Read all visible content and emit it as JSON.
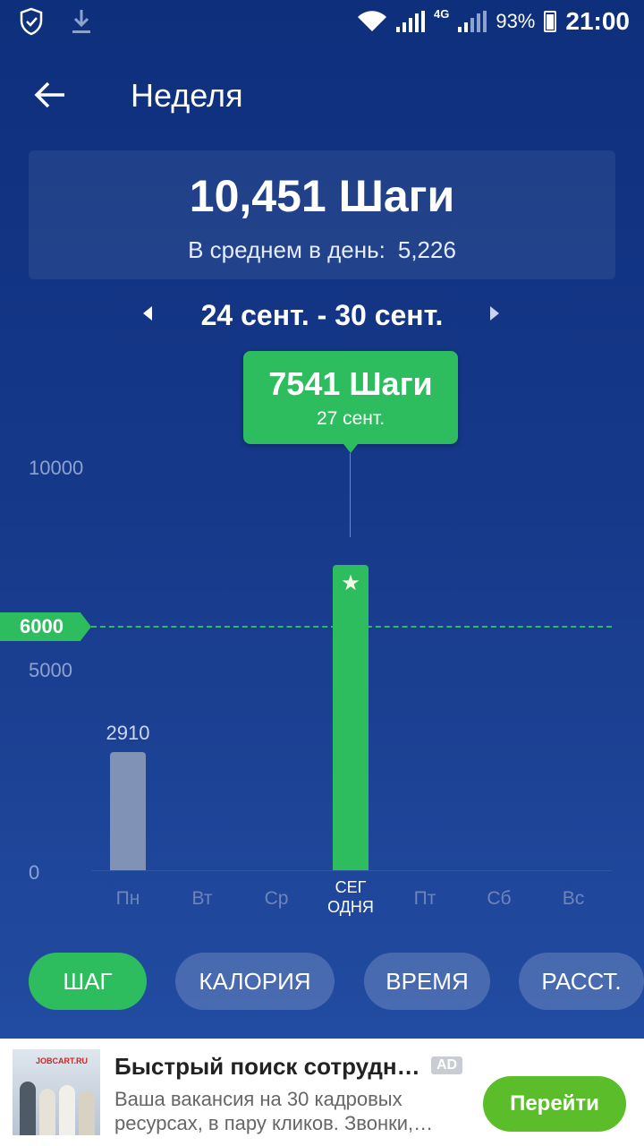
{
  "status": {
    "battery": "93%",
    "time": "21:00",
    "network": "4G",
    "icons": [
      "shield-check-icon",
      "download-icon",
      "wifi-icon",
      "signal-icon",
      "battery-icon"
    ]
  },
  "appbar": {
    "title": "Неделя",
    "back_icon": "arrow-left-icon"
  },
  "summary": {
    "total": "10,451 Шаги",
    "avg_label": "В среднем в день:",
    "avg_value": "5,226"
  },
  "range": {
    "label": "24 сент. - 30 сент."
  },
  "tooltip": {
    "value": "7541 Шаги",
    "date": "27 сент."
  },
  "chart_data": {
    "type": "bar",
    "categories": [
      "Пн",
      "Вт",
      "Ср",
      "СЕГ ОДНЯ",
      "Пт",
      "Сб",
      "Вс"
    ],
    "values": [
      2910,
      0,
      0,
      7541,
      0,
      0,
      0
    ],
    "ylim": [
      0,
      10000
    ],
    "yticks": [
      "10000",
      "5000",
      "0"
    ],
    "goal": 6000,
    "goal_label": "6000",
    "bar_labels": [
      "2910"
    ],
    "colors": {
      "goal": "#2dbd5f",
      "today": "#2dbd5f",
      "past": "#8092b5"
    }
  },
  "tabs": [
    {
      "label": "ШАГ",
      "active": true
    },
    {
      "label": "КАЛОРИЯ",
      "active": false
    },
    {
      "label": "ВРЕМЯ",
      "active": false
    },
    {
      "label": "РАССТ.",
      "active": false
    }
  ],
  "ad": {
    "brand": "JOBCART.RU",
    "title": "Быстрый поиск сотрудн…",
    "badge": "AD",
    "text": "Ваша вакансия на 30 кадровых ресурсах, в пару кликов. Звонки,…",
    "button": "Перейти"
  }
}
